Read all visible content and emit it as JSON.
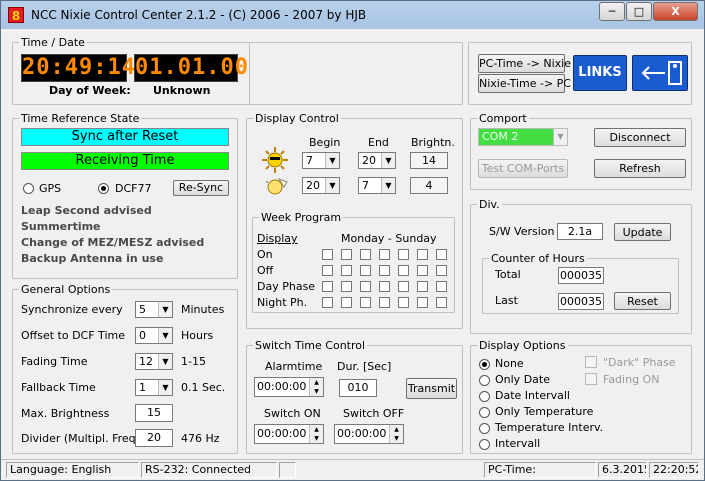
{
  "title": "NCC Nixie Control Center 2.1.2 - (C) 2006 - 2007 by HJB",
  "app_icon": "8",
  "window_buttons": {
    "minimize": "─",
    "maximize": "□",
    "close": "X"
  },
  "time_date": {
    "title": "Time / Date",
    "time": "20:49:14",
    "date": "01.01.00",
    "dow_label": "Day of Week:",
    "dow_value": "Unknown"
  },
  "top_buttons": {
    "pc_to_nixie": "PC-Time -> Nixie",
    "nixie_to_pc": "Nixie-Time -> PC",
    "links": "LINKS",
    "exit_icon": "exit-door-icon"
  },
  "time_ref": {
    "title": "Time Reference State",
    "sync": "Sync after Reset",
    "receiving": "Receiving Time",
    "gps": "GPS",
    "dcf": "DCF77",
    "resync": "Re-Sync",
    "status": [
      "Leap Second advised",
      "Summertime",
      "Change of MEZ/MESZ advised",
      "Backup Antenna in use"
    ]
  },
  "display_control": {
    "title": "Display Control",
    "col_begin": "Begin",
    "col_end": "End",
    "col_bright": "Brightn.",
    "day": {
      "begin": "7",
      "end": "20",
      "bright": "14"
    },
    "night": {
      "begin": "20",
      "end": "7",
      "bright": "4"
    }
  },
  "week_program": {
    "title": "Week Program",
    "display": "Display",
    "days": "Monday - Sunday",
    "rows": [
      "On",
      "Off",
      "Day Phase",
      "Night Ph."
    ]
  },
  "comport": {
    "title": "Comport",
    "port": "COM 2",
    "disconnect": "Disconnect",
    "test": "Test COM-Ports",
    "refresh": "Refresh"
  },
  "div": {
    "title": "Div.",
    "sw_label": "S/W Version",
    "sw_value": "2.1a",
    "update": "Update",
    "counter_title": "Counter of Hours",
    "total_label": "Total",
    "total_value": "000035",
    "last_label": "Last",
    "last_value": "000035",
    "reset": "Reset"
  },
  "general": {
    "title": "General Options",
    "sync_label": "Synchronize every",
    "sync_value": "5",
    "sync_unit": "Minutes",
    "offset_label": "Offset to DCF Time",
    "offset_value": "0",
    "offset_unit": "Hours",
    "fading_label": "Fading Time",
    "fading_value": "12",
    "fading_unit": "1-15",
    "fallback_label": "Fallback Time",
    "fallback_value": "1",
    "fallback_unit": "0.1 Sec.",
    "maxb_label": "Max. Brightness",
    "maxb_value": "15",
    "divider_label": "Divider (Multipl. Frequ.)",
    "divider_value": "20",
    "divider_unit": "476 Hz"
  },
  "switch_time": {
    "title": "Switch Time Control",
    "alarm_label": "Alarmtime",
    "alarm_value": "00:00:00",
    "dur_label": "Dur. [Sec]",
    "dur_value": "010",
    "transmit": "Transmit",
    "on_label": "Switch ON",
    "on_value": "00:00:00",
    "off_label": "Switch OFF",
    "off_value": "00:00:00"
  },
  "display_options": {
    "title": "Display Options",
    "none": "None",
    "only_date": "Only Date",
    "date_int": "Date Intervall",
    "only_temp": "Only Temperature",
    "temp_int": "Temperature Interv.",
    "intervall": "Intervall",
    "dark_phase": "\"Dark\" Phase",
    "fading_on": "Fading ON"
  },
  "status": {
    "language": "Language: English",
    "rs232": "RS-232: Connected",
    "pctime": "PC-Time:",
    "date": "6.3.2015",
    "time": "22:20:52"
  },
  "colors": {
    "cyan": "#00ffff",
    "green": "#00ff00",
    "led": "#ff8a00",
    "links": "#1a5cd0"
  }
}
